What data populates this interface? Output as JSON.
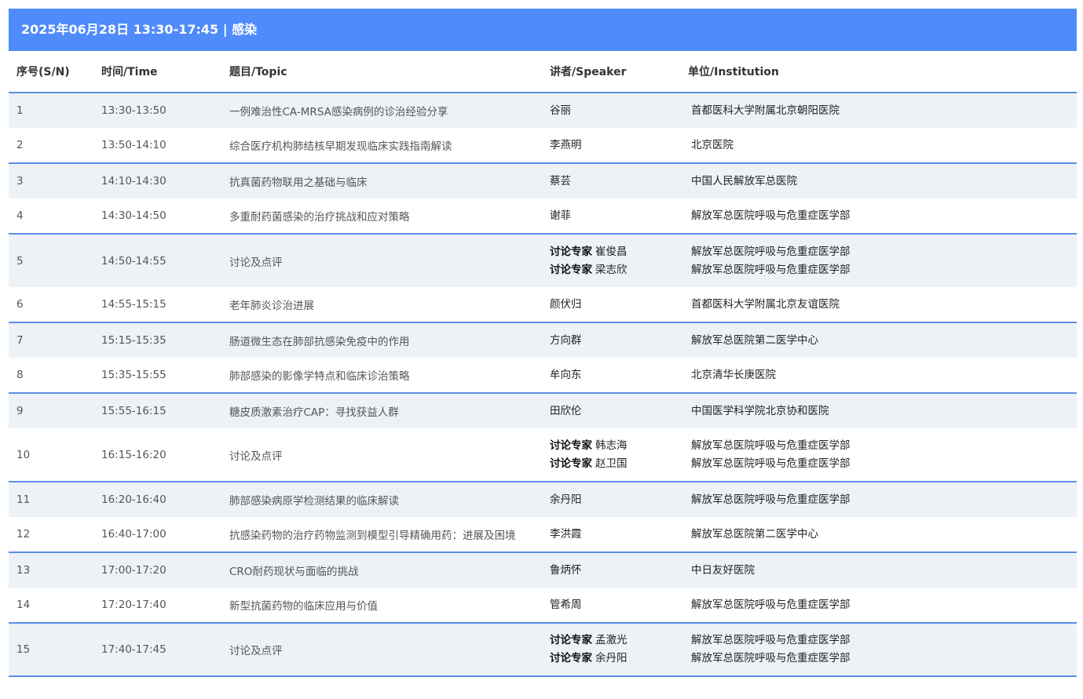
{
  "session": {
    "title": "2025年06月28日 13:30-17:45 | 感染"
  },
  "headers": {
    "sn": "序号(S/N)",
    "time": "时间/Time",
    "topic": "题目/Topic",
    "speaker": "讲者/Speaker",
    "institution": "单位/Institution"
  },
  "rows": [
    {
      "sn": "1",
      "time": "13:30-13:50",
      "topic": "一例难治性CA-MRSA感染病例的诊治经验分享",
      "speakers": [
        {
          "role": "",
          "name": "谷丽",
          "inst": "首都医科大学附属北京朝阳医院"
        }
      ]
    },
    {
      "sn": "2",
      "time": "13:50-14:10",
      "topic": "综合医疗机构肺结核早期发现临床实践指南解读",
      "speakers": [
        {
          "role": "",
          "name": "李燕明",
          "inst": "北京医院"
        }
      ]
    },
    {
      "sn": "3",
      "time": "14:10-14:30",
      "topic": "抗真菌药物联用之基础与临床",
      "speakers": [
        {
          "role": "",
          "name": "蔡芸",
          "inst": "中国人民解放军总医院"
        }
      ]
    },
    {
      "sn": "4",
      "time": "14:30-14:50",
      "topic": "多重耐药菌感染的治疗挑战和应对策略",
      "speakers": [
        {
          "role": "",
          "name": "谢菲",
          "inst": "解放军总医院呼吸与危重症医学部"
        }
      ]
    },
    {
      "sn": "5",
      "time": "14:50-14:55",
      "topic": "讨论及点评",
      "speakers": [
        {
          "role": "讨论专家",
          "name": "崔俊昌",
          "inst": "解放军总医院呼吸与危重症医学部"
        },
        {
          "role": "讨论专家",
          "name": "梁志欣",
          "inst": "解放军总医院呼吸与危重症医学部"
        }
      ]
    },
    {
      "sn": "6",
      "time": "14:55-15:15",
      "topic": "老年肺炎诊治进展",
      "speakers": [
        {
          "role": "",
          "name": "颜伏归",
          "inst": "首都医科大学附属北京友谊医院"
        }
      ]
    },
    {
      "sn": "7",
      "time": "15:15-15:35",
      "topic": "肠道微生态在肺部抗感染免疫中的作用",
      "speakers": [
        {
          "role": "",
          "name": "方向群",
          "inst": "解放军总医院第二医学中心"
        }
      ]
    },
    {
      "sn": "8",
      "time": "15:35-15:55",
      "topic": "肺部感染的影像学特点和临床诊治策略",
      "speakers": [
        {
          "role": "",
          "name": "牟向东",
          "inst": "北京清华长庚医院"
        }
      ]
    },
    {
      "sn": "9",
      "time": "15:55-16:15",
      "topic": "糖皮质激素治疗CAP：寻找获益人群",
      "speakers": [
        {
          "role": "",
          "name": "田欣伦",
          "inst": "中国医学科学院北京协和医院"
        }
      ]
    },
    {
      "sn": "10",
      "time": "16:15-16:20",
      "topic": "讨论及点评",
      "speakers": [
        {
          "role": "讨论专家",
          "name": "韩志海",
          "inst": "解放军总医院呼吸与危重症医学部"
        },
        {
          "role": "讨论专家",
          "name": "赵卫国",
          "inst": "解放军总医院呼吸与危重症医学部"
        }
      ]
    },
    {
      "sn": "11",
      "time": "16:20-16:40",
      "topic": "肺部感染病原学检测结果的临床解读",
      "speakers": [
        {
          "role": "",
          "name": "余丹阳",
          "inst": "解放军总医院呼吸与危重症医学部"
        }
      ]
    },
    {
      "sn": "12",
      "time": "16:40-17:00",
      "topic": "抗感染药物的治疗药物监测到模型引导精确用药：进展及困境",
      "speakers": [
        {
          "role": "",
          "name": "李洪霞",
          "inst": "解放军总医院第二医学中心"
        }
      ]
    },
    {
      "sn": "13",
      "time": "17:00-17:20",
      "topic": "CRO耐药现状与面临的挑战",
      "speakers": [
        {
          "role": "",
          "name": "鲁炳怀",
          "inst": "中日友好医院"
        }
      ]
    },
    {
      "sn": "14",
      "time": "17:20-17:40",
      "topic": "新型抗菌药物的临床应用与价值",
      "speakers": [
        {
          "role": "",
          "name": "管希周",
          "inst": "解放军总医院呼吸与危重症医学部"
        }
      ]
    },
    {
      "sn": "15",
      "time": "17:40-17:45",
      "topic": "讨论及点评",
      "speakers": [
        {
          "role": "讨论专家",
          "name": "孟激光",
          "inst": "解放军总医院呼吸与危重症医学部"
        },
        {
          "role": "讨论专家",
          "name": "余丹阳",
          "inst": "解放军总医院呼吸与危重症医学部"
        }
      ]
    }
  ]
}
